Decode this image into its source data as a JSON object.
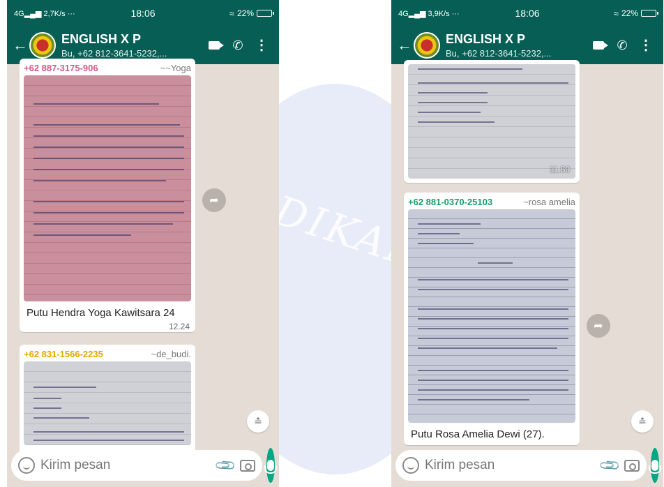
{
  "watermark": {
    "text": "DIKAN"
  },
  "left": {
    "status": {
      "network": "4G",
      "speed": "2,7K/s ···",
      "time": "18:06",
      "battery": "22%"
    },
    "header": {
      "group_name": "ENGLISH X P",
      "subtitle": "Bu, +62 812-3641-5232,..."
    },
    "messages": [
      {
        "sender_phone": "+62 887-3175-906",
        "sender_name": "~~Yoga",
        "caption": "Putu Hendra Yoga Kawitsara 24",
        "time": "12.24"
      },
      {
        "sender_phone": "+62 831-1566-2235",
        "sender_name": "~de_budi."
      }
    ],
    "composer": {
      "placeholder": "Kirim pesan"
    }
  },
  "right": {
    "status": {
      "network": "4G",
      "speed": "3,9K/s ···",
      "time": "18:06",
      "battery": "22%"
    },
    "header": {
      "group_name": "ENGLISH X P",
      "subtitle": "Bu, +62 812-3641-5232,..."
    },
    "messages": [
      {
        "time": "11.50"
      },
      {
        "sender_phone": "+62 881-0370-25103",
        "sender_name": "~rosa amelia",
        "caption": "Putu Rosa Amelia Dewi (27)."
      }
    ],
    "composer": {
      "placeholder": "Kirim pesan"
    }
  },
  "colors": {
    "header": "#075e54",
    "chat_bg": "#e5ddd5",
    "mic": "#00a884",
    "sender_1": "#d35a86",
    "sender_2": "#e0a800",
    "sender_3": "#1f9a6b"
  },
  "icons": [
    "back-arrow-icon",
    "video-call-icon",
    "phone-call-icon",
    "more-vert-icon",
    "forward-icon",
    "scroll-down-icon",
    "emoji-icon",
    "attach-icon",
    "camera-icon",
    "mic-icon"
  ]
}
